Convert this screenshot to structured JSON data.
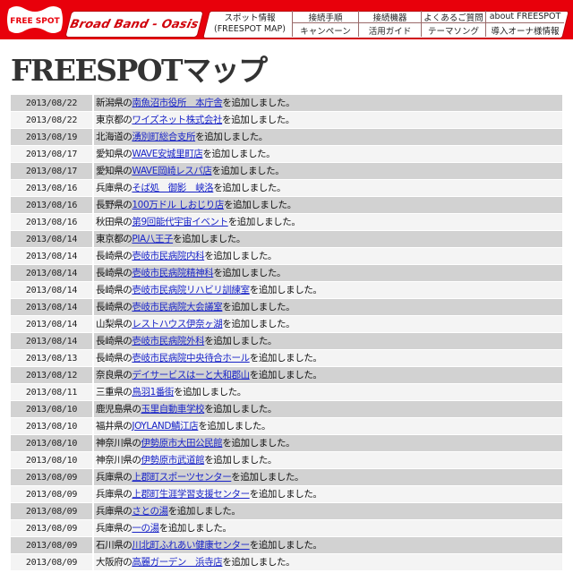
{
  "header": {
    "logo_text": "FREE SPOT",
    "brand": "Broad Band - Oasis",
    "nav": {
      "spot_line1": "スポット情報",
      "spot_line2": "(FREESPOT MAP)",
      "top": [
        "接続手順",
        "接続機器",
        "よくあるご質問",
        "about FREESPOT"
      ],
      "bottom": [
        "キャンペーン",
        "活用ガイド",
        "テーマソング",
        "導入オーナ様情報"
      ]
    },
    "colors": {
      "brand_red": "#e8000b",
      "link_blue": "#1a25c8"
    }
  },
  "page_title": "FREESPOTマップ",
  "suffix": "を追加しました。",
  "entries": [
    {
      "date": "2013/08/22",
      "prefix": "新潟県の",
      "link": "南魚沼市役所　本庁舎"
    },
    {
      "date": "2013/08/22",
      "prefix": "東京都の",
      "link": "ワイズネット株式会社"
    },
    {
      "date": "2013/08/19",
      "prefix": "北海道の",
      "link": "湧別町総合支所"
    },
    {
      "date": "2013/08/17",
      "prefix": "愛知県の",
      "link": "WAVE安城里町店"
    },
    {
      "date": "2013/08/17",
      "prefix": "愛知県の",
      "link": "WAVE岡崎レスパ店"
    },
    {
      "date": "2013/08/16",
      "prefix": "兵庫県の",
      "link": "そば処　御影　峡洛"
    },
    {
      "date": "2013/08/16",
      "prefix": "長野県の",
      "link": "100万ドル しおじり店"
    },
    {
      "date": "2013/08/16",
      "prefix": "秋田県の",
      "link": "第9回能代宇宙イベント"
    },
    {
      "date": "2013/08/14",
      "prefix": "東京都の",
      "link": "PIA八王子"
    },
    {
      "date": "2013/08/14",
      "prefix": "長崎県の",
      "link": "壱岐市民病院内科"
    },
    {
      "date": "2013/08/14",
      "prefix": "長崎県の",
      "link": "壱岐市民病院精神科"
    },
    {
      "date": "2013/08/14",
      "prefix": "長崎県の",
      "link": "壱岐市民病院リハビリ訓練室"
    },
    {
      "date": "2013/08/14",
      "prefix": "長崎県の",
      "link": "壱岐市民病院大会議室"
    },
    {
      "date": "2013/08/14",
      "prefix": "山梨県の",
      "link": "レストハウス伊奈ヶ湖"
    },
    {
      "date": "2013/08/14",
      "prefix": "長崎県の",
      "link": "壱岐市民病院外科"
    },
    {
      "date": "2013/08/13",
      "prefix": "長崎県の",
      "link": "壱岐市民病院中央待合ホール"
    },
    {
      "date": "2013/08/12",
      "prefix": "奈良県の",
      "link": "デイサービスはーと大和郡山"
    },
    {
      "date": "2013/08/11",
      "prefix": "三重県の",
      "link": "鳥羽1番街"
    },
    {
      "date": "2013/08/10",
      "prefix": "鹿児島県の",
      "link": "玉里自動車学校"
    },
    {
      "date": "2013/08/10",
      "prefix": "福井県の",
      "link": "JOYLAND鯖江店"
    },
    {
      "date": "2013/08/10",
      "prefix": "神奈川県の",
      "link": "伊勢原市大田公民館"
    },
    {
      "date": "2013/08/10",
      "prefix": "神奈川県の",
      "link": "伊勢原市武道館"
    },
    {
      "date": "2013/08/09",
      "prefix": "兵庫県の",
      "link": "上郡町スポーツセンター"
    },
    {
      "date": "2013/08/09",
      "prefix": "兵庫県の",
      "link": "上郡町生涯学習支援センター"
    },
    {
      "date": "2013/08/09",
      "prefix": "兵庫県の",
      "link": "さとの湯"
    },
    {
      "date": "2013/08/09",
      "prefix": "兵庫県の",
      "link": "一の湯"
    },
    {
      "date": "2013/08/09",
      "prefix": "石川県の",
      "link": "川北町ふれあい健康センター"
    },
    {
      "date": "2013/08/09",
      "prefix": "大阪府の",
      "link": "高麗ガーデン　浜寺店"
    }
  ]
}
